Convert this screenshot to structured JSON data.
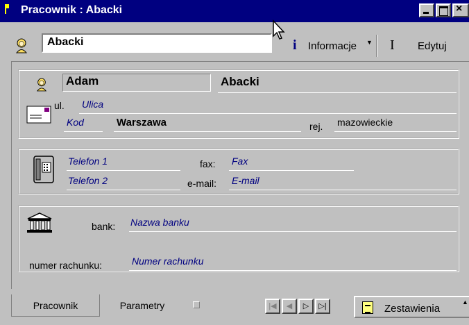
{
  "window": {
    "title": "Pracownik : Abacki",
    "controls": {
      "minimize": "_",
      "maximize": "□",
      "close": "✕"
    }
  },
  "header": {
    "name_value": "Abacki",
    "info_button": {
      "label": "Informacje",
      "icon": "info-icon"
    },
    "edit_button": {
      "label": "Edytuj",
      "icon": "text-cursor-icon"
    }
  },
  "person": {
    "first_name": "Adam",
    "last_name": "Abacki",
    "street_prefix": "ul.",
    "street_placeholder": "Ulica",
    "postal_placeholder": "Kod",
    "city": "Warszawa",
    "region_label": "rej.",
    "region_value": "mazowieckie"
  },
  "contact": {
    "phone1_placeholder": "Telefon 1",
    "phone2_placeholder": "Telefon 2",
    "fax_label": "fax:",
    "fax_placeholder": "Fax",
    "email_label": "e-mail:",
    "email_placeholder": "E-mail"
  },
  "bank": {
    "bank_label": "bank:",
    "bank_placeholder": "Nazwa banku",
    "account_label": "numer rachunku:",
    "account_placeholder": "Numer rachunku"
  },
  "tabs": [
    {
      "label": "Pracownik",
      "active": true
    },
    {
      "label": "Parametry",
      "active": false
    }
  ],
  "reports_button": {
    "label": "Zestawienia"
  },
  "colors": {
    "titlebar": "#000080",
    "window_bg": "#c0c0c0",
    "hint_text": "#000080"
  }
}
